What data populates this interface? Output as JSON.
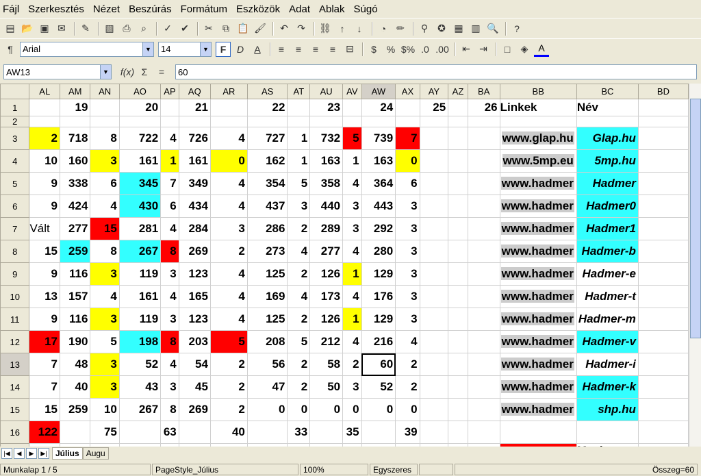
{
  "menu": [
    "Fájl",
    "Szerkesztés",
    "Nézet",
    "Beszúrás",
    "Formátum",
    "Eszközök",
    "Adat",
    "Ablak",
    "Súgó"
  ],
  "font_name": "Arial",
  "font_size": "14",
  "cell_ref": "AW13",
  "formula": "60",
  "columns": [
    "AL",
    "AM",
    "AN",
    "AO",
    "AP",
    "AQ",
    "AR",
    "AS",
    "AT",
    "AU",
    "AV",
    "AW",
    "AX",
    "AY",
    "AZ",
    "BA",
    "BB",
    "BC",
    "BD"
  ],
  "rows": [
    {
      "n": "1",
      "cells": [
        "",
        "19",
        "",
        "20",
        "",
        "21",
        "",
        "22",
        "",
        "23",
        "",
        "24",
        "",
        "25",
        "",
        "26",
        "Linkek",
        "Név",
        ""
      ]
    },
    {
      "n": "2",
      "cells": [
        "",
        "",
        "",
        "",
        "",
        "",
        "",
        "",
        "",
        "",
        "",
        "",
        "",
        "",
        "",
        "",
        "",
        "",
        ""
      ]
    },
    {
      "n": "3",
      "cells": [
        "2",
        "718",
        "8",
        "722",
        "4",
        "726",
        "4",
        "727",
        "1",
        "732",
        "5",
        "739",
        "7",
        "",
        "",
        "",
        "www.glap.hu",
        "Glap.hu",
        ""
      ]
    },
    {
      "n": "4",
      "cells": [
        "10",
        "160",
        "3",
        "161",
        "1",
        "161",
        "0",
        "162",
        "1",
        "163",
        "1",
        "163",
        "0",
        "",
        "",
        "",
        "www.5mp.eu",
        "5mp.hu",
        ""
      ]
    },
    {
      "n": "5",
      "cells": [
        "9",
        "338",
        "6",
        "345",
        "7",
        "349",
        "4",
        "354",
        "5",
        "358",
        "4",
        "364",
        "6",
        "",
        "",
        "",
        "www.hadmer",
        "Hadmer",
        ""
      ]
    },
    {
      "n": "6",
      "cells": [
        "9",
        "424",
        "4",
        "430",
        "6",
        "434",
        "4",
        "437",
        "3",
        "440",
        "3",
        "443",
        "3",
        "",
        "",
        "",
        "www.hadmer",
        "Hadmer0",
        ""
      ]
    },
    {
      "n": "7",
      "cells": [
        "Vált",
        "277",
        "15",
        "281",
        "4",
        "284",
        "3",
        "286",
        "2",
        "289",
        "3",
        "292",
        "3",
        "",
        "",
        "",
        "www.hadmer",
        "Hadmer1",
        ""
      ]
    },
    {
      "n": "8",
      "cells": [
        "15",
        "259",
        "8",
        "267",
        "8",
        "269",
        "2",
        "273",
        "4",
        "277",
        "4",
        "280",
        "3",
        "",
        "",
        "",
        "www.hadmer",
        "Hadmer-b",
        ""
      ]
    },
    {
      "n": "9",
      "cells": [
        "9",
        "116",
        "3",
        "119",
        "3",
        "123",
        "4",
        "125",
        "2",
        "126",
        "1",
        "129",
        "3",
        "",
        "",
        "",
        "www.hadmer",
        "Hadmer-e",
        ""
      ]
    },
    {
      "n": "10",
      "cells": [
        "13",
        "157",
        "4",
        "161",
        "4",
        "165",
        "4",
        "169",
        "4",
        "173",
        "4",
        "176",
        "3",
        "",
        "",
        "",
        "www.hadmer",
        "Hadmer-t",
        ""
      ]
    },
    {
      "n": "11",
      "cells": [
        "9",
        "116",
        "3",
        "119",
        "3",
        "123",
        "4",
        "125",
        "2",
        "126",
        "1",
        "129",
        "3",
        "",
        "",
        "",
        "www.hadmer",
        "Hadmer-m",
        ""
      ]
    },
    {
      "n": "12",
      "cells": [
        "17",
        "190",
        "5",
        "198",
        "8",
        "203",
        "5",
        "208",
        "5",
        "212",
        "4",
        "216",
        "4",
        "",
        "",
        "",
        "www.hadmer",
        "Hadmer-v",
        ""
      ]
    },
    {
      "n": "13",
      "cells": [
        "7",
        "48",
        "3",
        "52",
        "4",
        "54",
        "2",
        "56",
        "2",
        "58",
        "2",
        "60",
        "2",
        "",
        "",
        "",
        "www.hadmer",
        "Hadmer-i",
        ""
      ]
    },
    {
      "n": "14",
      "cells": [
        "7",
        "40",
        "3",
        "43",
        "3",
        "45",
        "2",
        "47",
        "2",
        "50",
        "3",
        "52",
        "2",
        "",
        "",
        "",
        "www.hadmer",
        "Hadmer-k",
        ""
      ]
    },
    {
      "n": "15",
      "cells": [
        "15",
        "259",
        "10",
        "267",
        "8",
        "269",
        "2",
        "0",
        "0",
        "0",
        "0",
        "0",
        "0",
        "",
        "",
        "",
        "www.hadmer",
        "shp.hu",
        ""
      ]
    },
    {
      "n": "16",
      "cells": [
        "122",
        "",
        "75",
        "",
        "63",
        "",
        "40",
        "",
        "33",
        "",
        "35",
        "",
        "39",
        "",
        "",
        "",
        "",
        "",
        ""
      ]
    },
    {
      "n": "17",
      "cells": [
        "",
        "",
        "",
        "",
        "",
        "",
        "",
        "",
        "",
        "",
        "",
        "",
        "",
        "",
        "",
        "",
        "",
        "Maximum",
        ""
      ]
    }
  ],
  "tabs": [
    "Július",
    "Augu"
  ],
  "status": {
    "sheet": "Munkalap 1 / 5",
    "style": "PageStyle_Július",
    "zoom": "100%",
    "mode": "Egyszeres",
    "sum": "Összeg=60"
  }
}
